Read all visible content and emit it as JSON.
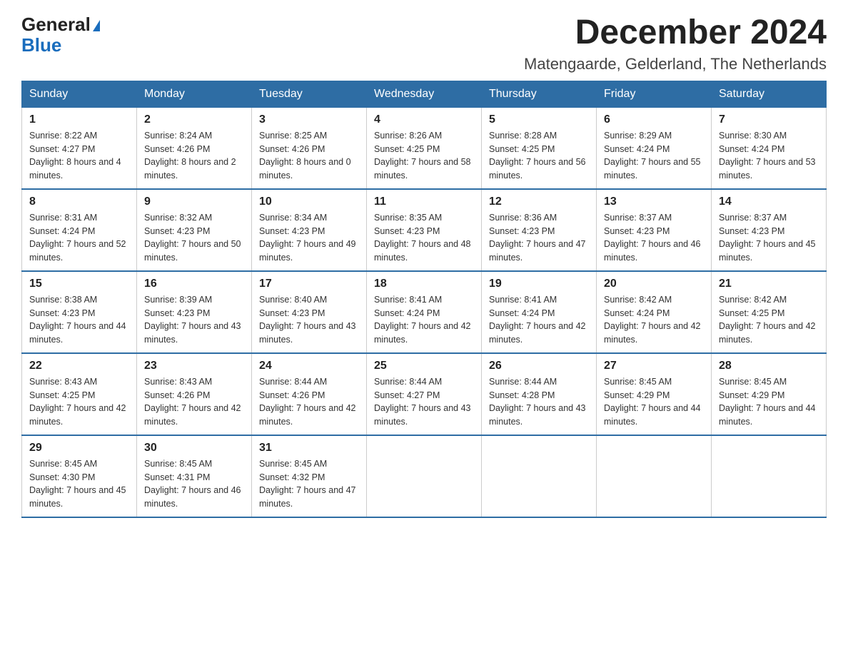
{
  "logo": {
    "general": "General",
    "blue": "Blue"
  },
  "header": {
    "month_year": "December 2024",
    "location": "Matengaarde, Gelderland, The Netherlands"
  },
  "weekdays": [
    "Sunday",
    "Monday",
    "Tuesday",
    "Wednesday",
    "Thursday",
    "Friday",
    "Saturday"
  ],
  "weeks": [
    [
      {
        "day": "1",
        "sunrise": "Sunrise: 8:22 AM",
        "sunset": "Sunset: 4:27 PM",
        "daylight": "Daylight: 8 hours and 4 minutes."
      },
      {
        "day": "2",
        "sunrise": "Sunrise: 8:24 AM",
        "sunset": "Sunset: 4:26 PM",
        "daylight": "Daylight: 8 hours and 2 minutes."
      },
      {
        "day": "3",
        "sunrise": "Sunrise: 8:25 AM",
        "sunset": "Sunset: 4:26 PM",
        "daylight": "Daylight: 8 hours and 0 minutes."
      },
      {
        "day": "4",
        "sunrise": "Sunrise: 8:26 AM",
        "sunset": "Sunset: 4:25 PM",
        "daylight": "Daylight: 7 hours and 58 minutes."
      },
      {
        "day": "5",
        "sunrise": "Sunrise: 8:28 AM",
        "sunset": "Sunset: 4:25 PM",
        "daylight": "Daylight: 7 hours and 56 minutes."
      },
      {
        "day": "6",
        "sunrise": "Sunrise: 8:29 AM",
        "sunset": "Sunset: 4:24 PM",
        "daylight": "Daylight: 7 hours and 55 minutes."
      },
      {
        "day": "7",
        "sunrise": "Sunrise: 8:30 AM",
        "sunset": "Sunset: 4:24 PM",
        "daylight": "Daylight: 7 hours and 53 minutes."
      }
    ],
    [
      {
        "day": "8",
        "sunrise": "Sunrise: 8:31 AM",
        "sunset": "Sunset: 4:24 PM",
        "daylight": "Daylight: 7 hours and 52 minutes."
      },
      {
        "day": "9",
        "sunrise": "Sunrise: 8:32 AM",
        "sunset": "Sunset: 4:23 PM",
        "daylight": "Daylight: 7 hours and 50 minutes."
      },
      {
        "day": "10",
        "sunrise": "Sunrise: 8:34 AM",
        "sunset": "Sunset: 4:23 PM",
        "daylight": "Daylight: 7 hours and 49 minutes."
      },
      {
        "day": "11",
        "sunrise": "Sunrise: 8:35 AM",
        "sunset": "Sunset: 4:23 PM",
        "daylight": "Daylight: 7 hours and 48 minutes."
      },
      {
        "day": "12",
        "sunrise": "Sunrise: 8:36 AM",
        "sunset": "Sunset: 4:23 PM",
        "daylight": "Daylight: 7 hours and 47 minutes."
      },
      {
        "day": "13",
        "sunrise": "Sunrise: 8:37 AM",
        "sunset": "Sunset: 4:23 PM",
        "daylight": "Daylight: 7 hours and 46 minutes."
      },
      {
        "day": "14",
        "sunrise": "Sunrise: 8:37 AM",
        "sunset": "Sunset: 4:23 PM",
        "daylight": "Daylight: 7 hours and 45 minutes."
      }
    ],
    [
      {
        "day": "15",
        "sunrise": "Sunrise: 8:38 AM",
        "sunset": "Sunset: 4:23 PM",
        "daylight": "Daylight: 7 hours and 44 minutes."
      },
      {
        "day": "16",
        "sunrise": "Sunrise: 8:39 AM",
        "sunset": "Sunset: 4:23 PM",
        "daylight": "Daylight: 7 hours and 43 minutes."
      },
      {
        "day": "17",
        "sunrise": "Sunrise: 8:40 AM",
        "sunset": "Sunset: 4:23 PM",
        "daylight": "Daylight: 7 hours and 43 minutes."
      },
      {
        "day": "18",
        "sunrise": "Sunrise: 8:41 AM",
        "sunset": "Sunset: 4:24 PM",
        "daylight": "Daylight: 7 hours and 42 minutes."
      },
      {
        "day": "19",
        "sunrise": "Sunrise: 8:41 AM",
        "sunset": "Sunset: 4:24 PM",
        "daylight": "Daylight: 7 hours and 42 minutes."
      },
      {
        "day": "20",
        "sunrise": "Sunrise: 8:42 AM",
        "sunset": "Sunset: 4:24 PM",
        "daylight": "Daylight: 7 hours and 42 minutes."
      },
      {
        "day": "21",
        "sunrise": "Sunrise: 8:42 AM",
        "sunset": "Sunset: 4:25 PM",
        "daylight": "Daylight: 7 hours and 42 minutes."
      }
    ],
    [
      {
        "day": "22",
        "sunrise": "Sunrise: 8:43 AM",
        "sunset": "Sunset: 4:25 PM",
        "daylight": "Daylight: 7 hours and 42 minutes."
      },
      {
        "day": "23",
        "sunrise": "Sunrise: 8:43 AM",
        "sunset": "Sunset: 4:26 PM",
        "daylight": "Daylight: 7 hours and 42 minutes."
      },
      {
        "day": "24",
        "sunrise": "Sunrise: 8:44 AM",
        "sunset": "Sunset: 4:26 PM",
        "daylight": "Daylight: 7 hours and 42 minutes."
      },
      {
        "day": "25",
        "sunrise": "Sunrise: 8:44 AM",
        "sunset": "Sunset: 4:27 PM",
        "daylight": "Daylight: 7 hours and 43 minutes."
      },
      {
        "day": "26",
        "sunrise": "Sunrise: 8:44 AM",
        "sunset": "Sunset: 4:28 PM",
        "daylight": "Daylight: 7 hours and 43 minutes."
      },
      {
        "day": "27",
        "sunrise": "Sunrise: 8:45 AM",
        "sunset": "Sunset: 4:29 PM",
        "daylight": "Daylight: 7 hours and 44 minutes."
      },
      {
        "day": "28",
        "sunrise": "Sunrise: 8:45 AM",
        "sunset": "Sunset: 4:29 PM",
        "daylight": "Daylight: 7 hours and 44 minutes."
      }
    ],
    [
      {
        "day": "29",
        "sunrise": "Sunrise: 8:45 AM",
        "sunset": "Sunset: 4:30 PM",
        "daylight": "Daylight: 7 hours and 45 minutes."
      },
      {
        "day": "30",
        "sunrise": "Sunrise: 8:45 AM",
        "sunset": "Sunset: 4:31 PM",
        "daylight": "Daylight: 7 hours and 46 minutes."
      },
      {
        "day": "31",
        "sunrise": "Sunrise: 8:45 AM",
        "sunset": "Sunset: 4:32 PM",
        "daylight": "Daylight: 7 hours and 47 minutes."
      },
      null,
      null,
      null,
      null
    ]
  ]
}
